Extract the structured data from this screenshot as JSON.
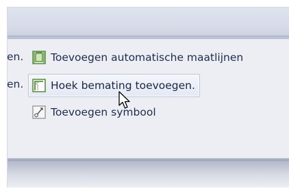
{
  "toolbar_menu": {
    "items": [
      {
        "prefix": "en.",
        "label": "Toevoegen automatische maatlijnen",
        "icon": "auto-dimension-icon"
      },
      {
        "prefix": "en.",
        "label": "Hoek bemating toevoegen.",
        "icon": "angle-dimension-icon",
        "hovered": true
      },
      {
        "prefix": "",
        "label": "Toevoegen symbool",
        "icon": "add-symbol-icon"
      }
    ]
  },
  "cursor": {
    "icon": "arrow-cursor-icon"
  },
  "colors": {
    "text": "#1f2c4e",
    "hover_border": "#b9c3d8",
    "panel_bg": "#eceef4",
    "icon_green": "#5a9a3a"
  }
}
